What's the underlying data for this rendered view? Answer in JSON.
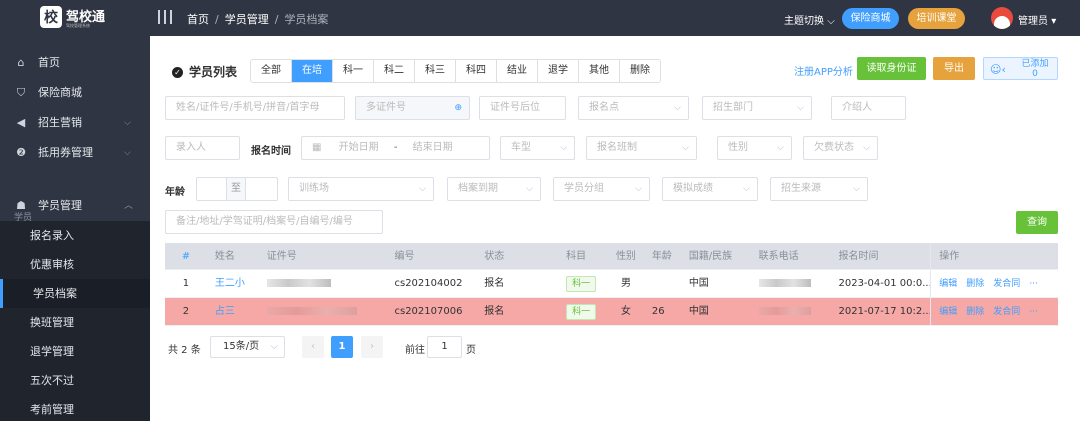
{
  "header": {
    "logo_char": "校",
    "logo_title": "驾校通",
    "logo_sub": "驾校管理系统",
    "breadcrumb": [
      "首页",
      "学员管理",
      "学员档案"
    ],
    "theme_switch": "主题切换",
    "mall_button": "保险商城",
    "training_button": "培训课堂",
    "user_name": "管理员"
  },
  "sidebar": {
    "items": [
      {
        "label": "首页",
        "icon": "home-icon"
      },
      {
        "label": "保险商城",
        "icon": "shield-icon"
      },
      {
        "label": "招生营销",
        "icon": "megaphone-icon"
      },
      {
        "label": "抵用券管理",
        "icon": "coupon-icon"
      }
    ],
    "group_label": "学员",
    "student_mgmt": "学员管理",
    "sub_items": [
      "报名录入",
      "优惠审核",
      "学员档案",
      "换班管理",
      "退学管理",
      "五次不过",
      "考前管理"
    ],
    "active_sub": "学员档案"
  },
  "list": {
    "title": "学员列表",
    "tabs": [
      "全部",
      "在培",
      "科一",
      "科二",
      "科三",
      "科四",
      "结业",
      "退学",
      "其他",
      "删除"
    ],
    "active_tab": "在培",
    "app_analysis_link": "注册APP分析",
    "read_id_button": "读取身份证",
    "export_button": "导出",
    "added_label": "已添加",
    "added_count": "0"
  },
  "filters": {
    "name_placeholder": "姓名/证件号/手机号/拼音/首字母",
    "multi_id_placeholder": "多证件号",
    "id_suffix_placeholder": "证件号后位",
    "signup_point": "报名点",
    "recruit_dept": "招生部门",
    "referrer": "介绍人",
    "entered_by": "录入人",
    "signup_time_label": "报名时间",
    "start_date": "开始日期",
    "date_sep": "-",
    "end_date": "结束日期",
    "vehicle_type": "车型",
    "signup_class": "报名班制",
    "gender": "性别",
    "arrears": "欠费状态",
    "age_label": "年龄",
    "age_to": "至",
    "training_field": "训练场",
    "file_due": "档案到期",
    "student_group": "学员分组",
    "mock_score": "模拟成绩",
    "recruit_source": "招生来源",
    "notes_placeholder": "备注/地址/学驾证明/档案号/自编号/编号",
    "query_button": "查询"
  },
  "table": {
    "columns": [
      "#",
      "姓名",
      "证件号",
      "编号",
      "状态",
      "科目",
      "性别",
      "年龄",
      "国籍/民族",
      "联系电话",
      "报名时间",
      "操作"
    ],
    "rows": [
      {
        "no": "1",
        "name": "王二小",
        "code": "cs202104002",
        "status": "报名",
        "subject": "科一",
        "gender": "男",
        "age": "",
        "nationality": "中国",
        "signup_time": "2023-04-01 00:0..."
      },
      {
        "no": "2",
        "name": "占三",
        "code": "cs202107006",
        "status": "报名",
        "subject": "科一",
        "gender": "女",
        "age": "26",
        "nationality": "中国",
        "signup_time": "2021-07-17 10:2..."
      }
    ],
    "actions": [
      "编辑",
      "删除",
      "发合同",
      "···"
    ]
  },
  "pager": {
    "total": "共 2 条",
    "page_size": "15条/页",
    "current_page": "1",
    "goto_label": "前往",
    "jump_value": "1",
    "page_unit": "页"
  },
  "colors": {
    "sidebar_bg": "#2f3542",
    "accent": "#409eff",
    "success": "#67c23a",
    "warning": "#e6a23c",
    "row_highlight": "#f5a8a5"
  }
}
